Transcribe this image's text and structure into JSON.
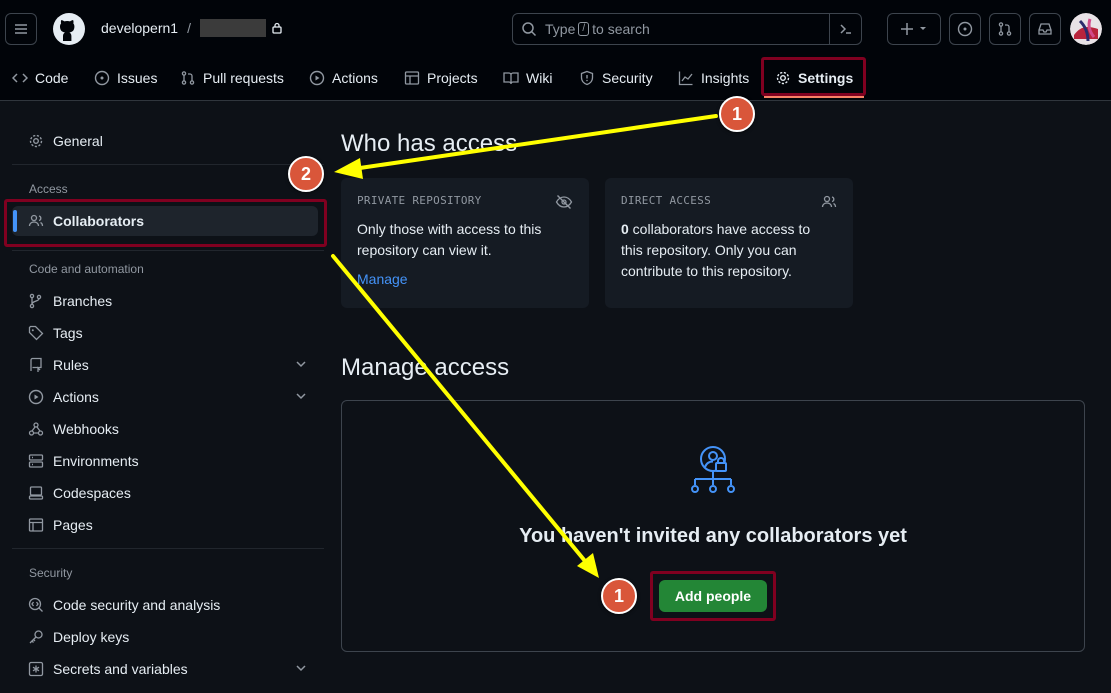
{
  "header": {
    "owner": "developern1",
    "separator": "/",
    "search": {
      "placeholder_before": "Type",
      "key": "/",
      "placeholder_after": "to search"
    }
  },
  "tabs": [
    {
      "label": "Code",
      "icon": "code-icon"
    },
    {
      "label": "Issues",
      "icon": "issue-icon"
    },
    {
      "label": "Pull requests",
      "icon": "pull-request-icon"
    },
    {
      "label": "Actions",
      "icon": "play-icon"
    },
    {
      "label": "Projects",
      "icon": "table-icon"
    },
    {
      "label": "Wiki",
      "icon": "book-icon"
    },
    {
      "label": "Security",
      "icon": "shield-icon"
    },
    {
      "label": "Insights",
      "icon": "graph-icon"
    },
    {
      "label": "Settings",
      "icon": "gear-icon"
    }
  ],
  "sidebar": {
    "general": "General",
    "access_heading": "Access",
    "collaborators": "Collaborators",
    "automation_heading": "Code and automation",
    "automation_items": [
      "Branches",
      "Tags",
      "Rules",
      "Actions",
      "Webhooks",
      "Environments",
      "Codespaces",
      "Pages"
    ],
    "security_heading": "Security",
    "security_items": [
      "Code security and analysis",
      "Deploy keys",
      "Secrets and variables"
    ]
  },
  "main": {
    "who_title": "Who has access",
    "private_card": {
      "label": "PRIVATE REPOSITORY",
      "text": "Only those with access to this repository can view it.",
      "link": "Manage"
    },
    "direct_card": {
      "label": "DIRECT ACCESS",
      "count": "0",
      "text": " collaborators have access to this repository. Only you can contribute to this repository."
    },
    "manage_title": "Manage access",
    "empty_text": "You haven't invited any collaborators yet",
    "add_button": "Add people"
  },
  "annotations": {
    "step1": "1",
    "step2": "2",
    "step1b": "1"
  },
  "colors": {
    "accent_underline": "#f78166",
    "annotation_box": "#800020",
    "annotation_arrow": "#ffff00",
    "step_badge": "#d9563a",
    "add_button": "#238636",
    "link": "#4493f8"
  }
}
